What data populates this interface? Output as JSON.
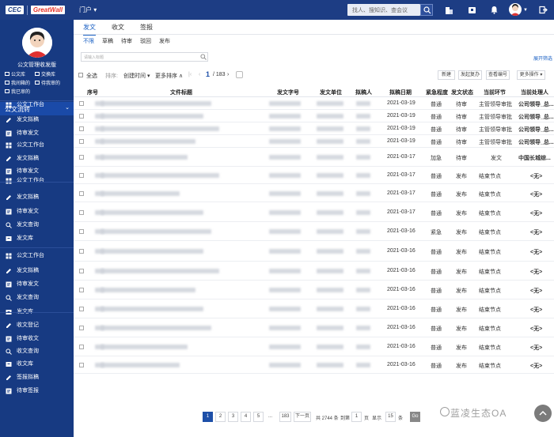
{
  "topbar": {
    "logo_left": "CEC",
    "logo_right": "GreatWall",
    "portal": "门户 ▾",
    "search_placeholder": "找人、搜知识、查会议"
  },
  "sidebar": {
    "user_name": "公文管理收发版",
    "shortcuts": [
      "公文库",
      "交换库",
      "我间箱的",
      "待我审的",
      "我已审的"
    ],
    "section_title": "公文流转",
    "items": [
      "公文工作台",
      "发文拟稿",
      "待审发文",
      "公文工作台",
      "发文拟稿",
      "待审发文",
      "公文工作台",
      "发文拟稿",
      "待审发文",
      "发文查询",
      "发文库",
      "公文工作台",
      "发文拟稿",
      "待审发文",
      "发文查询",
      "发文库",
      "收文登记",
      "待审收文",
      "收文查询",
      "收文库",
      "签报拟稿",
      "待审签报"
    ]
  },
  "tabs": [
    "发文",
    "收文",
    "签报"
  ],
  "subtabs": [
    "不限",
    "草稿",
    "待审",
    "驳回",
    "发布"
  ],
  "filter": {
    "placeholder": "请输入标题",
    "expand": "展开筛选"
  },
  "toolbar": {
    "select_all": "全选",
    "sort_label": "排序:",
    "sort_field": "创建时间 ▾",
    "more_sort": "更多排序 ∧",
    "page_current": "1",
    "page_total": "/ 183",
    "buttons": [
      "新建",
      "发起复办",
      "查看编号",
      "更多操作 ▾"
    ]
  },
  "table": {
    "columns": [
      "序号",
      "文件标题",
      "发文字号",
      "发文单位",
      "拟稿人",
      "拟稿日期",
      "紧急程度",
      "发文状态",
      "当前环节",
      "当前处理人"
    ],
    "rows": [
      {
        "date": "2021-03-19",
        "urgency": "普通",
        "status": "待审",
        "step": "主管领导审批",
        "handler": "公司领导_总..."
      },
      {
        "date": "2021-03-19",
        "urgency": "普通",
        "status": "待审",
        "step": "主管领导审批",
        "handler": "公司领导_总..."
      },
      {
        "date": "2021-03-19",
        "urgency": "普通",
        "status": "待审",
        "step": "主管领导审批",
        "handler": "公司领导_总..."
      },
      {
        "date": "2021-03-19",
        "urgency": "普通",
        "status": "待审",
        "step": "主管领导审批",
        "handler": "公司领导_总..."
      },
      {
        "date": "2021-03-17",
        "urgency": "加急",
        "status": "待审",
        "step": "发文",
        "handler": "中国长城综..."
      },
      {
        "date": "2021-03-17",
        "urgency": "普通",
        "status": "发布",
        "step": "结束节点",
        "handler": "<无>"
      },
      {
        "date": "2021-03-17",
        "urgency": "普通",
        "status": "发布",
        "step": "结束节点",
        "handler": "<无>"
      },
      {
        "date": "2021-03-17",
        "urgency": "普通",
        "status": "发布",
        "step": "结束节点",
        "handler": "<无>"
      },
      {
        "date": "2021-03-16",
        "urgency": "紧急",
        "status": "发布",
        "step": "结束节点",
        "handler": "<无>"
      },
      {
        "date": "2021-03-16",
        "urgency": "普通",
        "status": "发布",
        "step": "结束节点",
        "handler": "<无>"
      },
      {
        "date": "2021-03-16",
        "urgency": "普通",
        "status": "发布",
        "step": "结束节点",
        "handler": "<无>"
      },
      {
        "date": "2021-03-16",
        "urgency": "普通",
        "status": "发布",
        "step": "结束节点",
        "handler": "<无>"
      },
      {
        "date": "2021-03-16",
        "urgency": "普通",
        "status": "发布",
        "step": "结束节点",
        "handler": "<无>"
      },
      {
        "date": "2021-03-16",
        "urgency": "普通",
        "status": "发布",
        "step": "结束节点",
        "handler": "<无>"
      },
      {
        "date": "2021-03-16",
        "urgency": "普通",
        "status": "发布",
        "step": "结束节点",
        "handler": "<无>"
      },
      {
        "date": "2021-03-16",
        "urgency": "普通",
        "status": "发布",
        "step": "结束节点",
        "handler": "<无>"
      }
    ]
  },
  "pagination": {
    "pages": [
      "1",
      "2",
      "3",
      "4",
      "5"
    ],
    "ellipsis": "...",
    "last": "183",
    "next": "下一页",
    "total": "共 2744 条",
    "goto_label": "到第",
    "goto_value": "1",
    "page_unit": "页",
    "show_label": "显示",
    "size_value": "15",
    "size_unit": "条",
    "go": "Go"
  },
  "watermark": "蓝凌生态OA",
  "colors": {
    "sidebar": "#173a82",
    "topbar": "#1d3d84",
    "accent": "#1d62c4"
  }
}
